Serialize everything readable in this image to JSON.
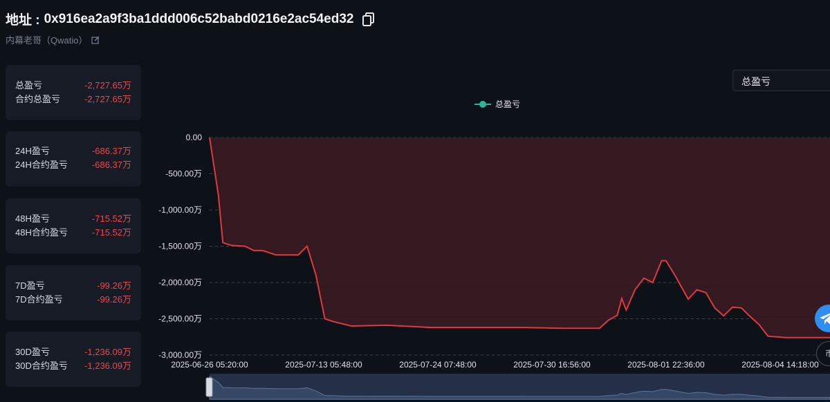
{
  "header": {
    "address_label": "地址 :",
    "address_value": "0x916ea2a9f3ba1ddd006c52babd0216e2ac54ed32",
    "subtitle": "内幕老哥（Qwatio）"
  },
  "stats": [
    {
      "rows": [
        {
          "label": "总盈亏",
          "value": "-2,727.65万"
        },
        {
          "label": "合约总盈亏",
          "value": "-2,727.65万"
        }
      ]
    },
    {
      "rows": [
        {
          "label": "24H盈亏",
          "value": "-686.37万"
        },
        {
          "label": "24H合约盈亏",
          "value": "-686.37万"
        }
      ]
    },
    {
      "rows": [
        {
          "label": "48H盈亏",
          "value": "-715.52万"
        },
        {
          "label": "48H合约盈亏",
          "value": "-715.52万"
        }
      ]
    },
    {
      "rows": [
        {
          "label": "7D盈亏",
          "value": "-99.26万"
        },
        {
          "label": "7D合约盈亏",
          "value": "-99.26万"
        }
      ]
    },
    {
      "rows": [
        {
          "label": "30D盈亏",
          "value": "-1,236.09万"
        },
        {
          "label": "30D合约盈亏",
          "value": "-1,236.09万"
        }
      ]
    }
  ],
  "select": {
    "value": "总盈亏"
  },
  "side_button": {
    "label": "币"
  },
  "colors": {
    "accent_teal": "#2bb59a",
    "loss_red": "#f0474a",
    "area_fill": "#3a1b22"
  },
  "chart_data": {
    "type": "area",
    "legend": [
      "总盈亏"
    ],
    "y_tick_labels": [
      "0.00",
      "-500.00万",
      "-1,000.00万",
      "-1,500.00万",
      "-2,000.00万",
      "-2,500.00万",
      "-3,000.00万"
    ],
    "y_ticks": [
      0,
      -500,
      -1000,
      -1500,
      -2000,
      -2500,
      -3000
    ],
    "ylim": [
      -3000,
      0
    ],
    "x_tick_labels": [
      "2025-06-26 05:20:00",
      "2025-07-13 05:48:00",
      "2025-07-24 07:48:00",
      "2025-07-30 16:56:00",
      "2025-08-01 22:36:00",
      "2025-08-04 14:18:00"
    ],
    "grid": true,
    "series": [
      {
        "name": "总盈亏",
        "x": [
          0,
          0.02,
          0.03,
          0.05,
          0.08,
          0.1,
          0.12,
          0.15,
          0.2,
          0.22,
          0.24,
          0.26,
          0.28,
          0.32,
          0.4,
          0.5,
          0.6,
          0.7,
          0.8,
          0.88,
          0.9,
          0.92,
          0.93,
          0.94,
          0.96,
          0.98,
          1.0,
          1.02,
          1.03,
          1.05,
          1.08,
          1.1,
          1.12,
          1.14,
          1.16,
          1.18,
          1.2,
          1.22,
          1.24,
          1.26,
          1.28,
          1.3,
          1.32,
          1.34,
          1.36,
          1.38,
          1.4
        ],
        "values": [
          0,
          -800,
          -1450,
          -1490,
          -1500,
          -1560,
          -1560,
          -1620,
          -1620,
          -1500,
          -1900,
          -2500,
          -2540,
          -2600,
          -2590,
          -2620,
          -2620,
          -2620,
          -2630,
          -2630,
          -2520,
          -2450,
          -2220,
          -2380,
          -2100,
          -1940,
          -2000,
          -1700,
          -1700,
          -1900,
          -2230,
          -2100,
          -2140,
          -2350,
          -2460,
          -2340,
          -2350,
          -2470,
          -2580,
          -2740,
          -2750,
          -2760,
          -2760,
          -2760,
          -2760,
          -2760,
          -2760
        ]
      }
    ]
  }
}
